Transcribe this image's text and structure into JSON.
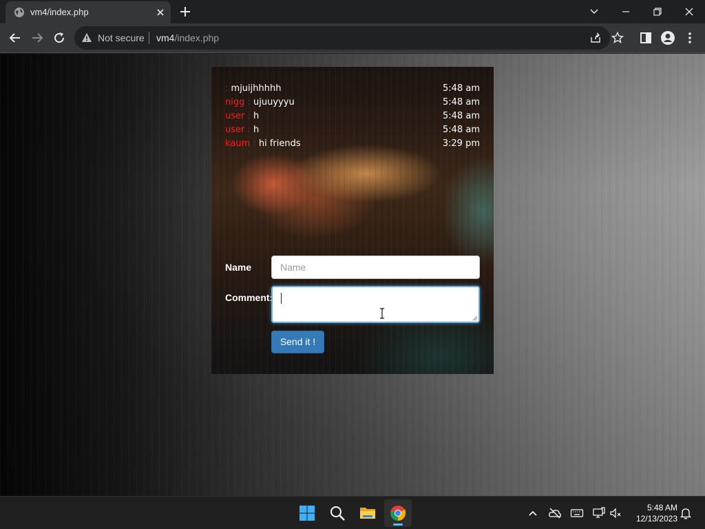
{
  "browser": {
    "tab_title": "vm4/index.php",
    "security_label": "Not secure",
    "url_host": "vm4",
    "url_path": "/index.php"
  },
  "chat": {
    "messages": [
      {
        "user": "",
        "separator": ":",
        "text": "mjuijhhhhh",
        "time": "5:48 am"
      },
      {
        "user": "nigg",
        "separator": ":",
        "text": "ujuuyyyu",
        "time": "5:48 am"
      },
      {
        "user": "user",
        "separator": ":",
        "text": "h",
        "time": "5:48 am"
      },
      {
        "user": "user",
        "separator": ":",
        "text": "h",
        "time": "5:48 am"
      },
      {
        "user": "kaum",
        "separator": ":",
        "text": "hi friends",
        "time": "3:29 pm"
      }
    ]
  },
  "form": {
    "name_label": "Name",
    "name_placeholder": "Name",
    "comment_label": "Comment:",
    "send_label": "Send it !"
  },
  "taskbar": {
    "time": "5:48 AM",
    "date": "12/13/2023"
  },
  "colors": {
    "username": "#ff1a1a",
    "send_button": "#337ab7",
    "focus_ring": "#66afe9"
  }
}
